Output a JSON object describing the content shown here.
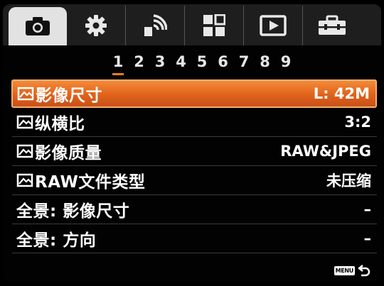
{
  "tabs": [
    {
      "icon": "camera-icon",
      "active": true
    },
    {
      "icon": "gear-icon",
      "active": false
    },
    {
      "icon": "wireless-icon",
      "active": false
    },
    {
      "icon": "custom-layout-icon",
      "active": false
    },
    {
      "icon": "playback-icon",
      "active": false
    },
    {
      "icon": "toolbox-icon",
      "active": false
    }
  ],
  "pages": [
    "1",
    "2",
    "3",
    "4",
    "5",
    "6",
    "7",
    "8",
    "9"
  ],
  "active_page": "1",
  "rows": [
    {
      "label": "影像尺寸",
      "value": "L: 42M",
      "still_icon": true,
      "selected": true
    },
    {
      "label": "纵横比",
      "value": "3:2",
      "still_icon": true,
      "selected": false
    },
    {
      "label": "影像质量",
      "value": "RAW&JPEG",
      "still_icon": true,
      "selected": false
    },
    {
      "label": "RAW文件类型",
      "value": "未压缩",
      "still_icon": true,
      "selected": false
    },
    {
      "label": "全景: 影像尺寸",
      "value": "–",
      "still_icon": false,
      "selected": false
    },
    {
      "label": "全景: 方向",
      "value": "–",
      "still_icon": false,
      "selected": false
    }
  ],
  "footer": {
    "menu_badge": "MENU",
    "back_icon": "return-arrow-icon"
  },
  "colors": {
    "accent": "#f07c22",
    "selected_bg": "#e0621a",
    "tab_bg": "#1e1e1e",
    "active_tab_bg": "#e2e2e2"
  }
}
